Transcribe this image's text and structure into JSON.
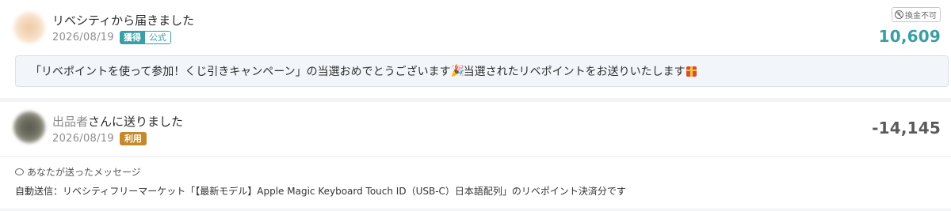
{
  "transactions": [
    {
      "title": "リベシティから届きました",
      "date": "2026/08/19",
      "badge_primary": "獲得",
      "badge_secondary": "公式",
      "exchange_label": "換金不可",
      "amount": "10,609",
      "message_part1": "「リベポイントを使って参加！くじ引きキャンペーン」の当選おめでとうございます",
      "message_part2": "当選されたリベポイントをお送りいたします",
      "accent_color": "#3a9ea5"
    },
    {
      "title_muted": "出品者",
      "title_rest": "さんに送りました",
      "date": "2026/08/19",
      "badge_primary": "利用",
      "amount": "-14,145",
      "sent_label": "あなたが送ったメッセージ",
      "auto_message": "自動送信：リベシティフリーマーケット「【最新モデル】Apple Magic Keyboard Touch ID（USB-C）日本語配列」のリベポイント決済分です",
      "accent_color": "#c4892b"
    }
  ],
  "icons": {
    "party": "party-popper-icon",
    "gift": "gift-icon",
    "no_exchange": "no-yen-icon",
    "speech": "speech-bubble-icon"
  }
}
